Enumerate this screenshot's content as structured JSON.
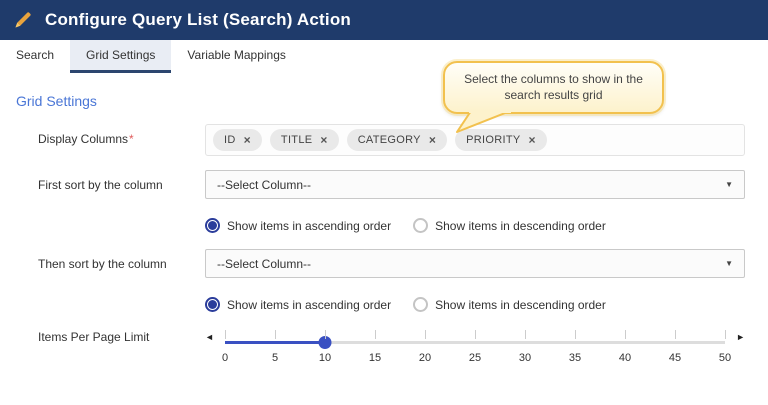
{
  "header": {
    "title": "Configure Query List (Search) Action",
    "icon": "pencil-icon"
  },
  "tabs": [
    {
      "label": "Search",
      "active": false
    },
    {
      "label": "Grid Settings",
      "active": true
    },
    {
      "label": "Variable Mappings",
      "active": false
    }
  ],
  "section_title": "Grid Settings",
  "tooltip": {
    "text": "Select the columns to show in the search results grid"
  },
  "form": {
    "display_columns": {
      "label": "Display Columns",
      "required_mark": "*",
      "tags": [
        "ID",
        "TITLE",
        "CATEGORY",
        "PRIORITY"
      ],
      "remove_icon": "×"
    },
    "first_sort": {
      "label": "First sort by the column",
      "value": "--Select Column--",
      "caret_icon": "▼"
    },
    "then_sort": {
      "label": "Then sort by the column",
      "value": "--Select Column--",
      "caret_icon": "▼"
    },
    "sort_order": {
      "options": [
        {
          "id": "ascending",
          "label": "Show items in ascending order"
        },
        {
          "id": "descending",
          "label": "Show items in descending order"
        }
      ],
      "first_selected": "ascending",
      "then_selected": "ascending"
    },
    "items_per_page": {
      "label": "Items Per Page Limit",
      "min": 0,
      "max": 50,
      "step": 5,
      "value": 10,
      "ticks": [
        "0",
        "5",
        "10",
        "15",
        "20",
        "25",
        "30",
        "35",
        "40",
        "45",
        "50"
      ],
      "left_arrow_icon": "◄",
      "right_arrow_icon": "►"
    }
  },
  "colors": {
    "header_bg": "#1f3b6b",
    "active_tab_bg": "#e9edf4",
    "active_tab_underline": "#2c466f",
    "section_title_blue": "#4a76d6",
    "radio_selected": "#2b3d9b",
    "slider_blue": "#3a50c2",
    "tag_bg": "#e9e9e9",
    "tooltip_border": "#f2c14e",
    "tooltip_bg": "#fdf2cc",
    "pencil_gold": "#e8a33d",
    "required_red": "#e05c5c"
  }
}
